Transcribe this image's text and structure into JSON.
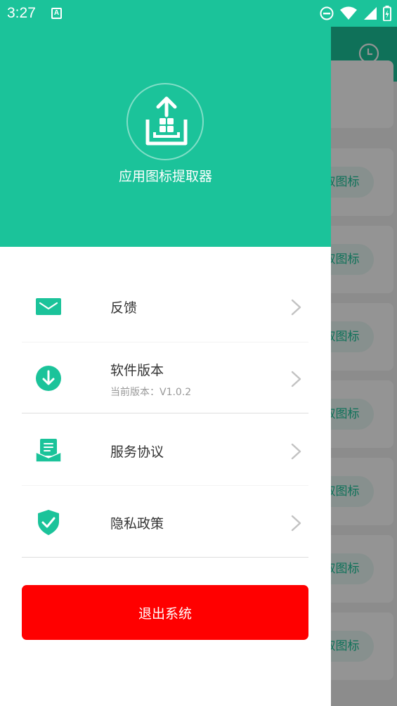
{
  "status_bar": {
    "time": "3:27",
    "app_icon_letter": "A"
  },
  "background": {
    "card_button_label": "取图标",
    "card_count": 7
  },
  "drawer": {
    "app_name": "应用图标提取器",
    "menu": [
      {
        "id": "feedback",
        "label": "反馈",
        "icon": "mail-icon"
      },
      {
        "id": "version",
        "label": "软件版本",
        "sub": "当前版本：V1.0.2",
        "icon": "download-icon"
      },
      {
        "id": "service",
        "label": "服务协议",
        "icon": "agreement-icon"
      },
      {
        "id": "privacy",
        "label": "隐私政策",
        "icon": "shield-check-icon"
      }
    ],
    "logout_label": "退出系统"
  },
  "colors": {
    "primary": "#1bc39a",
    "danger": "#ff0000"
  }
}
